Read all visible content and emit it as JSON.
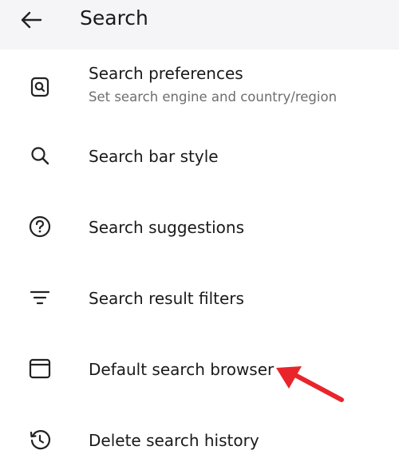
{
  "header": {
    "title": "Search",
    "back_icon": "arrow-left-icon"
  },
  "items": [
    {
      "title": "Search preferences",
      "subtitle": "Set search engine and country/region",
      "icon": "search-in-box-icon"
    },
    {
      "title": "Search bar style",
      "icon": "magnifier-icon"
    },
    {
      "title": "Search suggestions",
      "icon": "question-circle-icon"
    },
    {
      "title": "Search result filters",
      "icon": "filter-lines-icon"
    },
    {
      "title": "Default search browser",
      "icon": "browser-window-icon"
    },
    {
      "title": "Delete search history",
      "icon": "history-clock-icon"
    }
  ],
  "annotation": {
    "arrow_color": "#e8252b"
  }
}
